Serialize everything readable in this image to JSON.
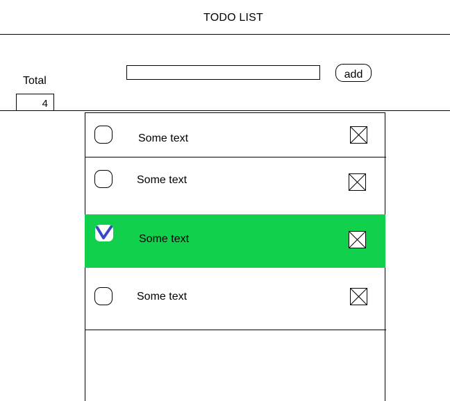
{
  "header": {
    "title": "TODO LIST"
  },
  "summary": {
    "total_label": "Total",
    "total_value": "4"
  },
  "form": {
    "input_value": "",
    "input_placeholder": "",
    "add_label": "add"
  },
  "colors": {
    "done_background": "#11d14c",
    "check_mark": "#3b49c9"
  },
  "icons": {
    "checkbox": "circle-checkbox-icon",
    "checked": "check-mark-icon",
    "delete": "delete-x-box-icon"
  },
  "todos": [
    {
      "text": "Some text",
      "done": false
    },
    {
      "text": "Some text",
      "done": false
    },
    {
      "text": "Some text",
      "done": true
    },
    {
      "text": "Some text",
      "done": false
    }
  ]
}
